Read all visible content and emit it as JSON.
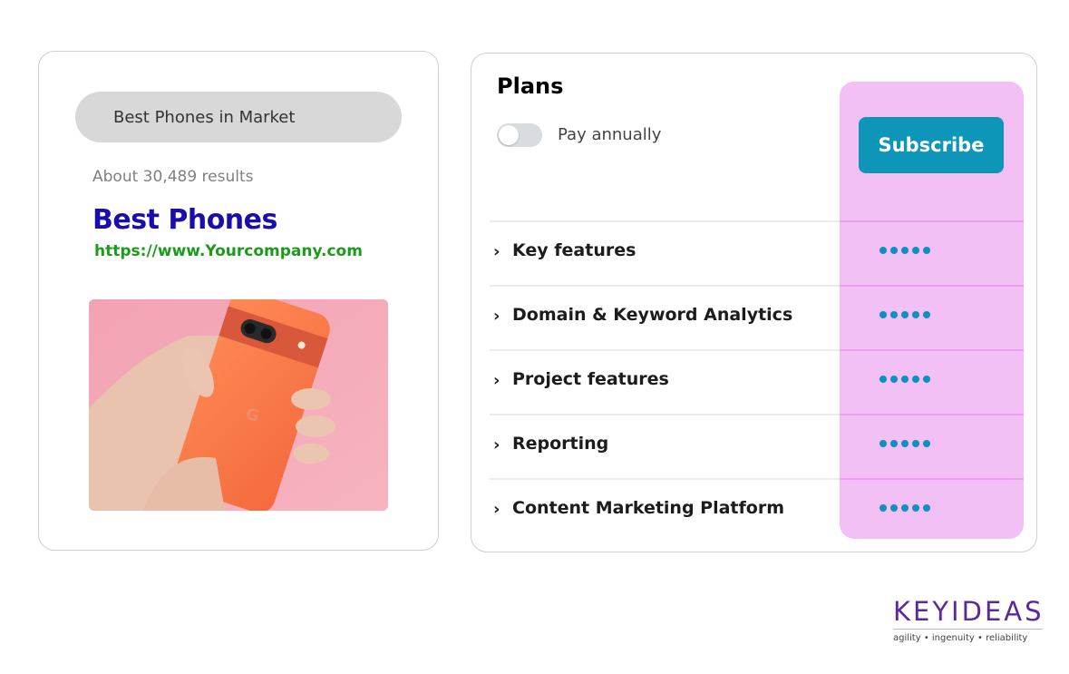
{
  "search": {
    "query": "Best Phones in Market",
    "results_count": "About 30,489 results",
    "result_title": "Best Phones",
    "result_url": "https://www.Yourcompany.com",
    "image_icon": "hand-holding-phone-image"
  },
  "plans": {
    "title": "Plans",
    "toggle_label": "Pay annually",
    "toggle_on": false,
    "subscribe_label": "Subscribe",
    "features": [
      {
        "label": "Key features",
        "chevron": "›",
        "rating": 5
      },
      {
        "label": "Domain & Keyword Analytics",
        "chevron": "›",
        "rating": 5
      },
      {
        "label": "Project features",
        "chevron": "›",
        "rating": 5
      },
      {
        "label": "Reporting",
        "chevron": "›",
        "rating": 5
      },
      {
        "label": "Content Marketing Platform",
        "chevron": "›",
        "rating": 5
      }
    ]
  },
  "brand": {
    "name": "KEYIDEAS",
    "tagline": "agility  •  ingenuity  •  reliability"
  },
  "colors": {
    "accent": "#0e96b8",
    "highlight": "#f3c0f5",
    "link_title": "#1a0dab",
    "link_url": "#1a9c1a",
    "brand": "#5a2a9c"
  }
}
